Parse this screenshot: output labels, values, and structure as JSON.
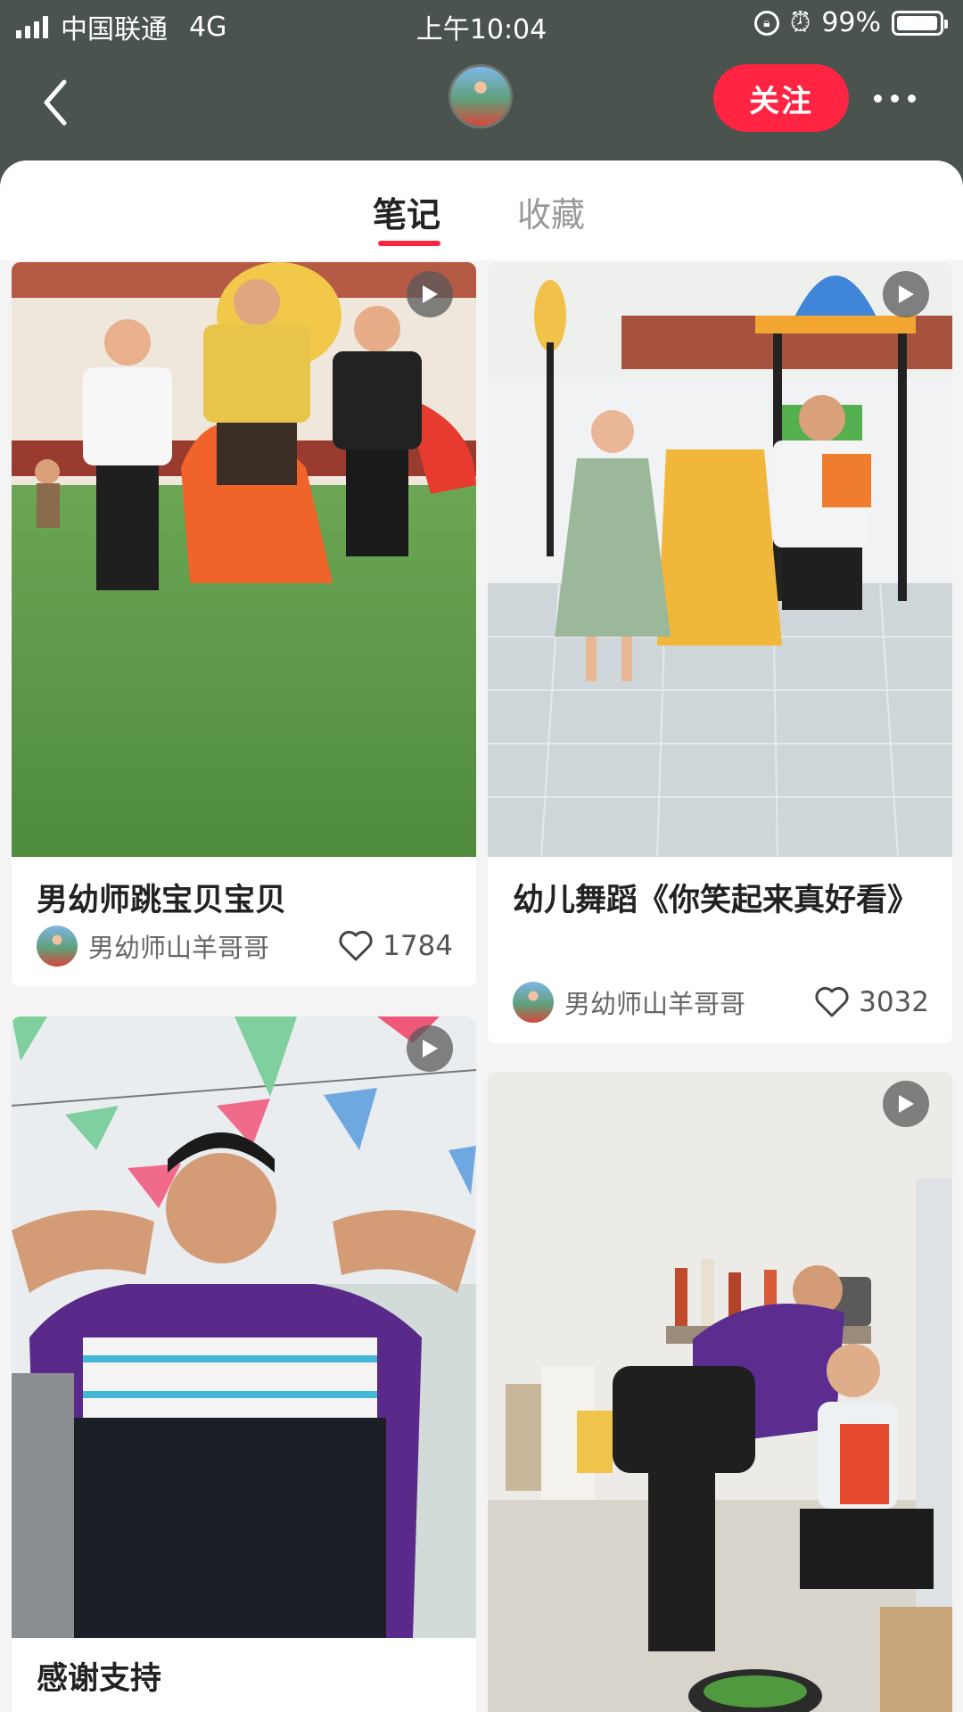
{
  "status_bar": {
    "carrier": "中国联通",
    "network": "4G",
    "time": "上午10:04",
    "battery": "99%"
  },
  "header": {
    "follow_label": "关注",
    "avatar_icon": "user-avatar"
  },
  "tabs": [
    {
      "label": "笔记",
      "active": true
    },
    {
      "label": "收藏",
      "active": false
    }
  ],
  "notes": [
    {
      "title": "男幼师跳宝贝宝贝",
      "author": "男幼师山羊哥哥",
      "likes": "1784",
      "type": "video"
    },
    {
      "title": "幼儿舞蹈《你笑起来真好看》",
      "author": "男幼师山羊哥哥",
      "likes": "3032",
      "type": "video"
    },
    {
      "title": "感谢支持",
      "type": "video"
    },
    {
      "type": "video"
    }
  ],
  "colors": {
    "accent": "#ff2442",
    "header_bg": "#4a534e",
    "feed_bg": "#f4f4f4"
  }
}
